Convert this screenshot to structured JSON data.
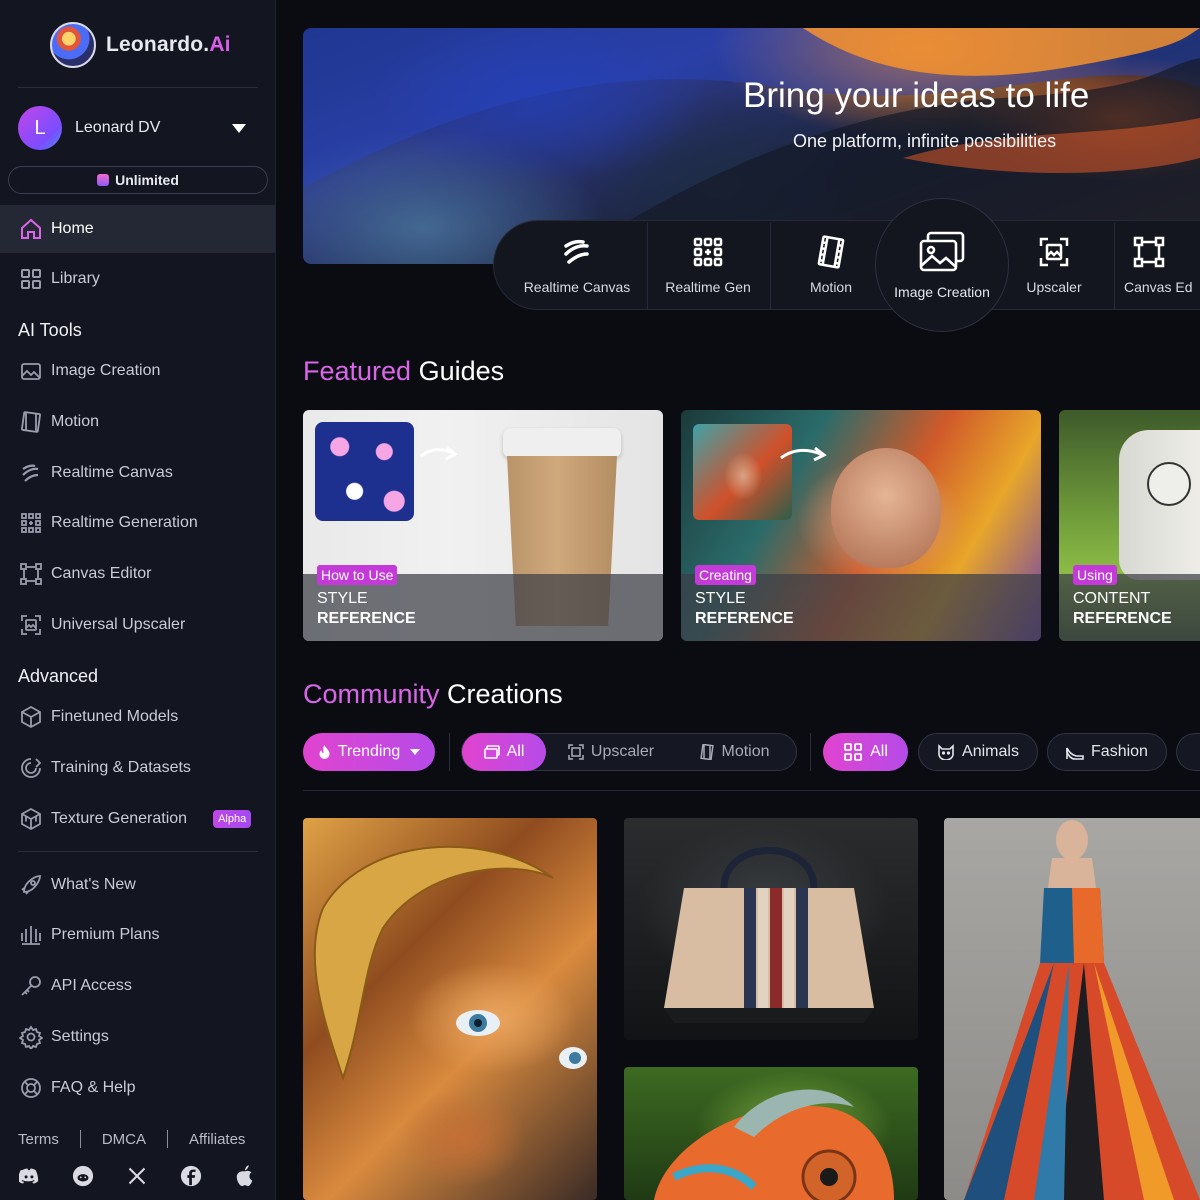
{
  "brand": {
    "name": "Leonardo.",
    "suffix": "Ai"
  },
  "user": {
    "initial": "L",
    "name": "Leonard DV",
    "plan": "Unlimited"
  },
  "nav": {
    "home": "Home",
    "library": "Library",
    "ai_tools_title": "AI Tools",
    "ai_tools": [
      "Image Creation",
      "Motion",
      "Realtime Canvas",
      "Realtime Generation",
      "Canvas Editor",
      "Universal Upscaler"
    ],
    "advanced_title": "Advanced",
    "advanced": [
      "Finetuned Models",
      "Training & Datasets",
      "Texture Generation"
    ],
    "texture_badge": "Alpha",
    "bottom": [
      "What's New",
      "Premium Plans",
      "API Access",
      "Settings",
      "FAQ & Help"
    ]
  },
  "footer": {
    "links": [
      "Terms",
      "DMCA",
      "Affiliates"
    ],
    "socials": [
      "discord-icon",
      "reddit-icon",
      "x-icon",
      "facebook-icon",
      "apple-icon"
    ]
  },
  "hero": {
    "title": "Bring your ideas to life",
    "subtitle": "One platform, infinite possibilities"
  },
  "tools": [
    "Realtime Canvas",
    "Realtime Gen",
    "Motion",
    "Image Creation",
    "Upscaler",
    "Canvas Ed"
  ],
  "featured": {
    "title_accent": "Featured",
    "title_rest": "Guides",
    "guides": [
      {
        "tag": "How to Use",
        "line1": "STYLE",
        "line2": "REFERENCE"
      },
      {
        "tag": "Creating",
        "line1": "STYLE",
        "line2": "REFERENCE"
      },
      {
        "tag": "Using",
        "line1": "CONTENT",
        "line2": "REFERENCE"
      }
    ]
  },
  "community": {
    "title_accent": "Community",
    "title_rest": "Creations",
    "sort": "Trending",
    "media": [
      "All",
      "Upscaler",
      "Motion"
    ],
    "categories": [
      "All",
      "Animals",
      "Fashion"
    ]
  },
  "colors": {
    "accent": "#d966e8",
    "sidebar": "#131520",
    "background": "#0b0c12"
  }
}
